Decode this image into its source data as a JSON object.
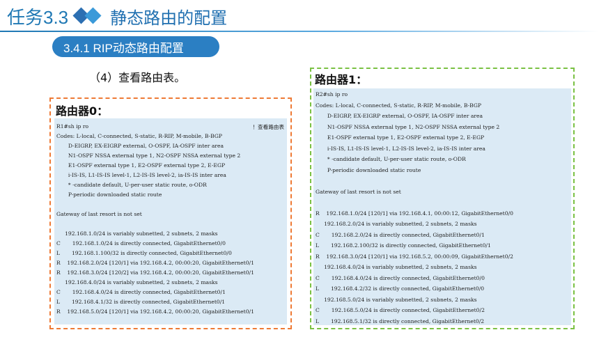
{
  "header": {
    "chapter": "任务3.3",
    "subject": "静态路由的配置",
    "icon": "diamond-icon"
  },
  "section": {
    "label": "3.4.1 RIP动态路由配置"
  },
  "step": "（4）查看路由表。",
  "router0": {
    "label": "路由器0：",
    "note": "！查看路由表",
    "lines": [
      "R1#sh ip ro",
      "Codes: L-local, C-connected, S-static, R-RIP, M-mobile, B-BGP",
      "       D-EIGRP, EX-EIGRP external, O-OSPF, IA-OSPF inter area",
      "       N1-OSPF NSSA external type 1, N2-OSPF NSSA external type 2",
      "       E1-OSPF external type 1, E2-OSPF external type 2, E-EGP",
      "       i-IS-IS, L1-IS-IS level-1, L2-IS-IS level-2, ia-IS-IS inter area",
      "       * -candidate default, U-per-user static route, o-ODR",
      "       P-periodic downloaded static route",
      "",
      "Gateway of last resort is not set",
      "",
      "     192.168.1.0/24 is variably subnetted, 2 subnets, 2 masks",
      "C       192.168.1.0/24 is directly connected, GigabitEthernet0/0",
      "L       192.168.1.100/32 is directly connected, GigabitEthernet0/0",
      "R    192.168.2.0/24 [120/1] via 192.168.4.2, 00:00:20, GigabitEthernet0/1",
      "R    192.168.3.0/24 [120/2] via 192.168.4.2, 00:00:20, GigabitEthernet0/1",
      "     192.168.4.0/24 is variably subnetted, 2 subnets, 2 masks",
      "C       192.168.4.0/24 is directly connected, GigabitEthernet0/1",
      "L       192.168.4.1/32 is directly connected, GigabitEthernet0/1",
      "R    192.168.5.0/24 [120/1] via 192.168.4.2, 00:00:20, GigabitEthernet0/1"
    ]
  },
  "router1": {
    "label": "路由器1：",
    "lines": [
      "R2#sh ip ro",
      "Codes: L-local, C-connected, S-static, R-RIP, M-mobile, B-BGP",
      "       D-EIGRP, EX-EIGRP external, O-OSPF, IA-OSPF inter area",
      "       N1-OSPF NSSA external type 1, N2-OSPF NSSA external type 2",
      "       E1-OSPF external type 1, E2-OSPF external type 2, E-EGP",
      "       i-IS-IS, L1-IS-IS level-1, L2-IS-IS level-2, ia-IS-IS inter area",
      "       * -candidate default, U-per-user static route, o-ODR",
      "       P-periodic downloaded static route",
      "",
      "Gateway of last resort is not set",
      "",
      "R    192.168.1.0/24 [120/1] via 192.168.4.1, 00:00:12, GigabitEthernet0/0",
      "     192.168.2.0/24 is variably subnetted, 2 subnets, 2 masks",
      "C       192.168.2.0/24 is directly connected, GigabitEthernet0/1",
      "L       192.168.2.100/32 is directly connected, GigabitEthernet0/1",
      "R    192.168.3.0/24 [120/1] via 192.168.5.2, 00:00:09, GigabitEthernet0/2",
      "     192.168.4.0/24 is variably subnetted, 2 subnets, 2 masks",
      "C       192.168.4.0/24 is directly connected, GigabitEthernet0/0",
      "L       192.168.4.2/32 is directly connected, GigabitEthernet0/0",
      "     192.168.5.0/24 is variably subnetted, 2 subnets, 2 masks",
      "C       192.168.5.0/24 is directly connected, GigabitEthernet0/2",
      "L       192.168.5.1/32 is directly connected, GigabitEthernet0/2"
    ]
  }
}
